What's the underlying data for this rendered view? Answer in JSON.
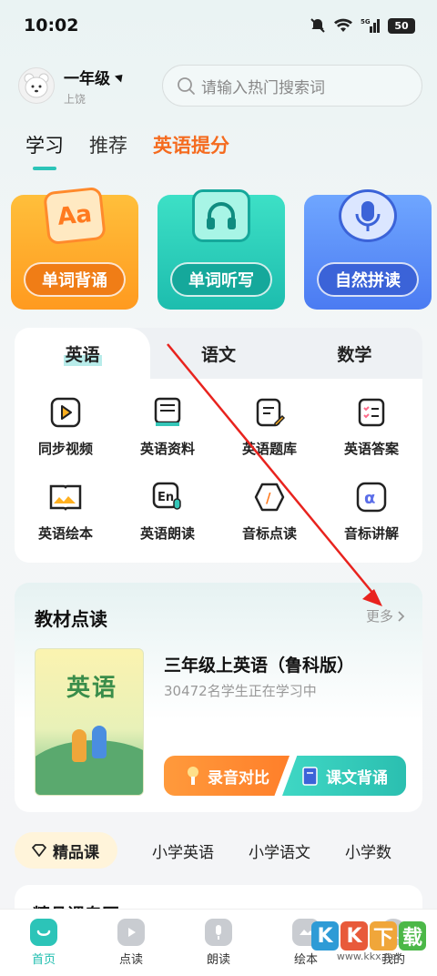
{
  "status_bar": {
    "time": "10:02",
    "signal_label": "5G",
    "battery": "50"
  },
  "header": {
    "grade": "一年级",
    "location": "上饶",
    "search_placeholder": "请输入热门搜索词"
  },
  "tabs": [
    "学习",
    "推荐",
    "英语提分"
  ],
  "feature_cards": [
    {
      "label": "单词背诵",
      "icon": "aa-card-icon",
      "icon_text": "Aa"
    },
    {
      "label": "单词听写",
      "icon": "headphones-icon"
    },
    {
      "label": "自然拼读",
      "icon": "microphone-icon"
    }
  ],
  "subjects": [
    "英语",
    "语文",
    "数学"
  ],
  "tools": [
    {
      "label": "同步视频",
      "icon": "video-play-icon"
    },
    {
      "label": "英语资料",
      "icon": "book-stack-icon"
    },
    {
      "label": "英语题库",
      "icon": "document-edit-icon"
    },
    {
      "label": "英语答案",
      "icon": "checklist-icon"
    },
    {
      "label": "英语绘本",
      "icon": "picture-book-icon"
    },
    {
      "label": "英语朗读",
      "icon": "en-mic-icon",
      "icon_text": "En"
    },
    {
      "label": "音标点读",
      "icon": "phonetic-slash-icon",
      "icon_text": "/"
    },
    {
      "label": "音标讲解",
      "icon": "alpha-icon",
      "icon_text": "α"
    }
  ],
  "textbook": {
    "section_title": "教材点读",
    "more_label": "更多",
    "book_title": "三年级上英语（鲁科版）",
    "learners": "30472名学生正在学习中",
    "cover_word": "英语",
    "record_button": "录音对比",
    "recite_button": "课文背诵"
  },
  "categories": [
    "精品课",
    "小学英语",
    "小学语文",
    "小学数"
  ],
  "next_section_title": "精品课专区",
  "bottom_nav": [
    {
      "label": "首页",
      "icon": "home-icon"
    },
    {
      "label": "点读",
      "icon": "play-card-icon"
    },
    {
      "label": "朗读",
      "icon": "mic-card-icon"
    },
    {
      "label": "绘本",
      "icon": "picture-book-icon"
    },
    {
      "label": "我的",
      "icon": "user-icon"
    }
  ],
  "watermark": {
    "letters": [
      "K",
      "K",
      "下",
      "载"
    ],
    "url": "www.kkx.net"
  },
  "colors": {
    "accent_teal": "#2cc4b8",
    "accent_orange": "#f56b1f",
    "annotation_red": "#e8231e"
  }
}
